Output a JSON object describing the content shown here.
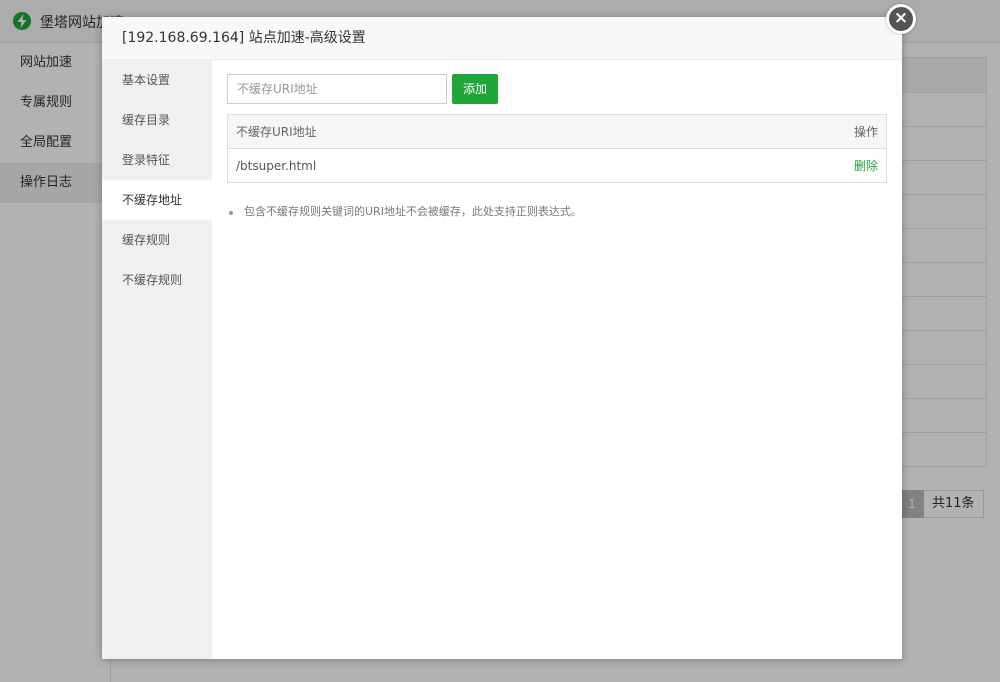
{
  "app": {
    "title": "堡塔网站加速",
    "sidebar": [
      {
        "label": "网站加速"
      },
      {
        "label": "专属规则"
      },
      {
        "label": "全局配置"
      },
      {
        "label": "操作日志"
      }
    ],
    "pager": {
      "current_page": "1",
      "total": "共11条"
    }
  },
  "modal": {
    "title": "[192.168.69.164] 站点加速-高级设置",
    "nav": [
      {
        "label": "基本设置"
      },
      {
        "label": "缓存目录"
      },
      {
        "label": "登录特征"
      },
      {
        "label": "不缓存地址"
      },
      {
        "label": "缓存规则"
      },
      {
        "label": "不缓存规则"
      }
    ],
    "active_nav": "不缓存地址",
    "input": {
      "placeholder": "不缓存URI地址",
      "value": ""
    },
    "add_label": "添加",
    "table": {
      "columns": [
        "不缓存URI地址",
        "操作"
      ],
      "rows": [
        {
          "uri": "/btsuper.html",
          "action": "删除"
        }
      ]
    },
    "tips": [
      "包含不缓存规则关键词的URI地址不会被缓存，此处支持正则表达式。"
    ]
  },
  "colors": {
    "accent": "#20a53a",
    "overlay": "rgba(0,0,0,0.3)"
  },
  "icons": {
    "logo": "lightning-bolt-icon",
    "close": "close-icon"
  }
}
